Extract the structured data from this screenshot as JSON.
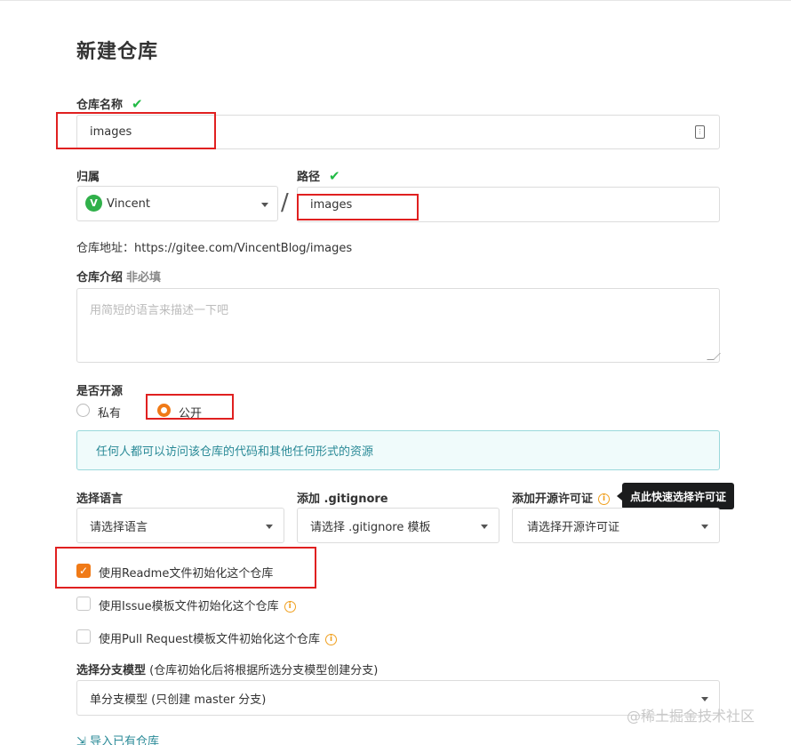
{
  "page": {
    "title": "新建仓库"
  },
  "repo_name": {
    "label": "仓库名称",
    "value": "images"
  },
  "owner": {
    "label": "归属",
    "avatar_letter": "V",
    "value": "Vincent"
  },
  "path": {
    "label": "路径",
    "separator": "/",
    "value": "images"
  },
  "repo_url": {
    "text": "仓库地址：https://gitee.com/VincentBlog/images"
  },
  "intro": {
    "label": "仓库介绍",
    "optional": "非必填",
    "placeholder": "用简短的语言来描述一下吧"
  },
  "visibility": {
    "label": "是否开源",
    "options": [
      {
        "label": "私有",
        "selected": false
      },
      {
        "label": "公开",
        "selected": true
      }
    ],
    "notice": "任何人都可以访问该仓库的代码和其他任何形式的资源"
  },
  "language": {
    "label": "选择语言",
    "value": "请选择语言"
  },
  "gitignore": {
    "label": "添加 .gitignore",
    "value": "请选择 .gitignore 模板"
  },
  "license": {
    "label": "添加开源许可证",
    "value": "请选择开源许可证",
    "tooltip": "点此快速选择许可证"
  },
  "init_options": [
    {
      "label": "使用Readme文件初始化这个仓库",
      "checked": true,
      "info": false
    },
    {
      "label": "使用Issue模板文件初始化这个仓库",
      "checked": false,
      "info": true
    },
    {
      "label": "使用Pull Request模板文件初始化这个仓库",
      "checked": false,
      "info": true
    }
  ],
  "branch_model": {
    "label": "选择分支模型",
    "hint": "(仓库初始化后将根据所选分支模型创建分支)",
    "value": "单分支模型 (只创建 master 分支)"
  },
  "import_link": {
    "label": "导入已有仓库"
  },
  "watermark": "@稀土掘金技术社区",
  "colors": {
    "accent": "#f07a17",
    "check": "#21ba45",
    "highlight_box": "#e02020",
    "notice_text": "#2a8a97"
  }
}
